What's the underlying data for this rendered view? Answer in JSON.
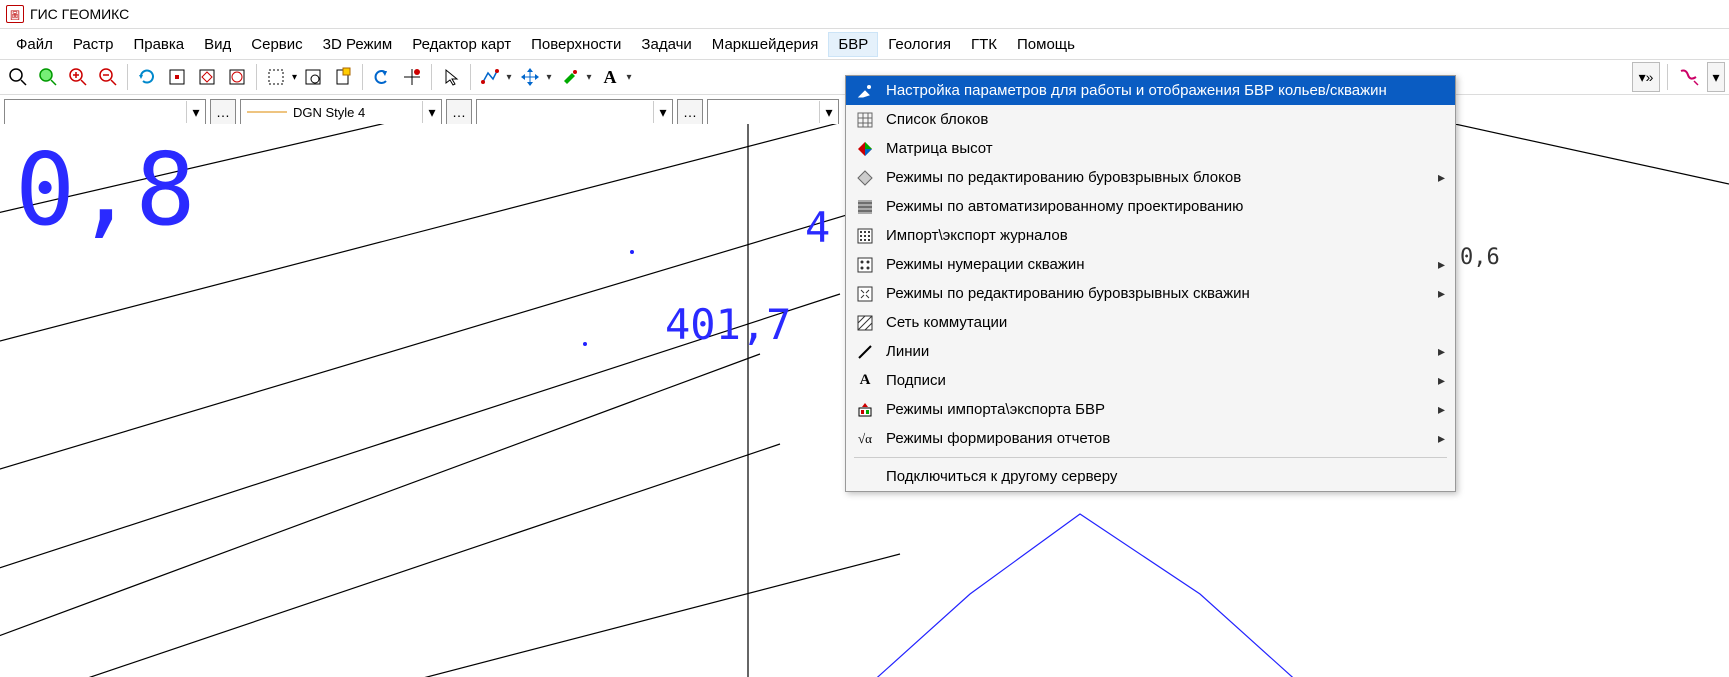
{
  "app": {
    "title": "ГИС ГЕОМИКС"
  },
  "menubar": {
    "items": [
      "Файл",
      "Растр",
      "Правка",
      "Вид",
      "Сервис",
      "3D Режим",
      "Редактор карт",
      "Поверхности",
      "Задачи",
      "Маркшейдерия",
      "БВР",
      "Геология",
      "ГТК",
      "Помощь"
    ],
    "active_index": 10
  },
  "selector_bar": {
    "style_label": "DGN Style 4"
  },
  "dropdown": {
    "items": [
      {
        "label": "Настройка параметров для работы и отображения БВР кольев/скважин",
        "sub": false,
        "selected": true,
        "icon": "config"
      },
      {
        "label": "Список блоков",
        "sub": false,
        "icon": "grid"
      },
      {
        "label": "Матрица высот",
        "sub": false,
        "icon": "rgb"
      },
      {
        "label": "Режимы по редактированию буровзрывных блоков",
        "sub": true,
        "icon": "diamond"
      },
      {
        "label": "Режимы по автоматизированному проектированию",
        "sub": false,
        "icon": "hatch1"
      },
      {
        "label": "Импорт\\экспорт журналов",
        "sub": false,
        "icon": "hatch2"
      },
      {
        "label": "Режимы нумерации скважин",
        "sub": true,
        "icon": "hatch3"
      },
      {
        "label": "Режимы по редактированию буровзрывных скважин",
        "sub": true,
        "icon": "hatch4"
      },
      {
        "label": "Сеть коммутации",
        "sub": false,
        "icon": "hatch5"
      },
      {
        "label": "Линии",
        "sub": true,
        "icon": "line"
      },
      {
        "label": "Подписи",
        "sub": true,
        "icon": "letter"
      },
      {
        "label": "Режимы импорта\\экспорта БВР",
        "sub": true,
        "icon": "importexport"
      },
      {
        "label": "Режимы формирования отчетов",
        "sub": true,
        "icon": "formula"
      }
    ],
    "last_item": "Подключиться к другому серверу"
  },
  "canvas": {
    "labels": {
      "big": "0,8",
      "mid1": "4",
      "mid2": "401,7",
      "right": "0,6"
    }
  }
}
